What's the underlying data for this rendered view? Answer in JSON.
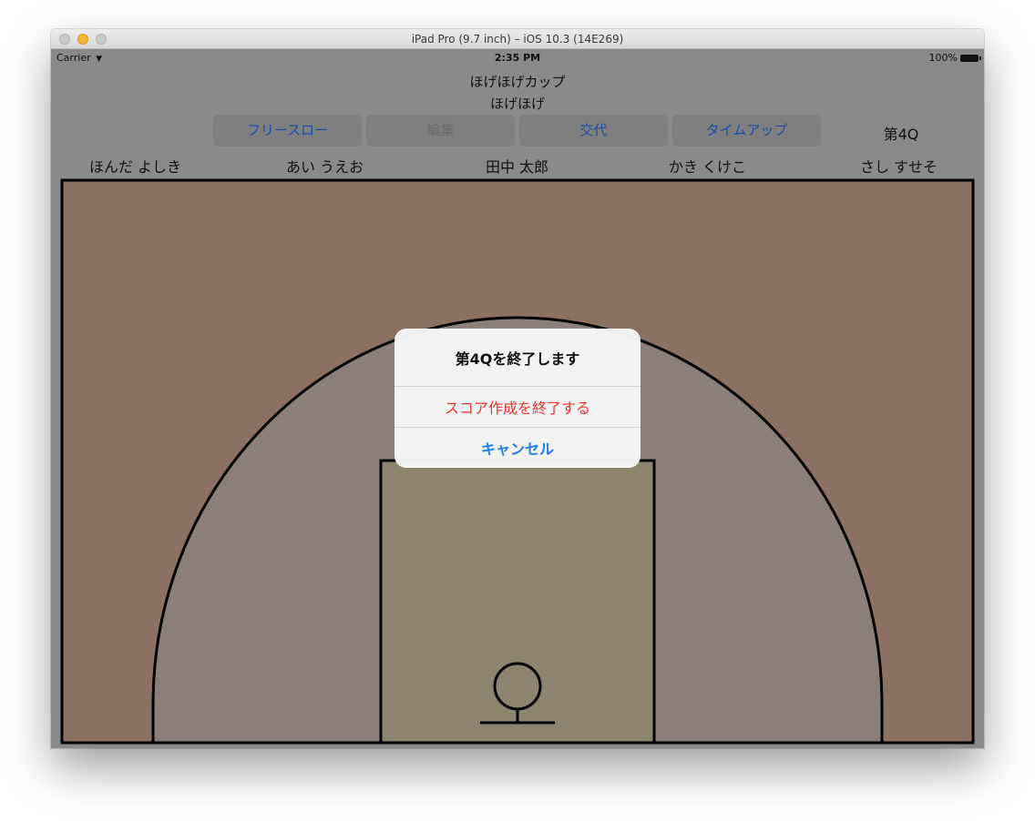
{
  "window": {
    "title": "iPad Pro (9.7 inch) – iOS 10.3 (14E269)"
  },
  "statusbar": {
    "carrier": "Carrier",
    "time": "2:35 PM",
    "battery": "100%"
  },
  "game": {
    "title": "ほげほげカップ",
    "subtitle": "ほげほげ"
  },
  "toolbar": {
    "free_throw": "フリースロー",
    "edit": "編集",
    "substitution": "交代",
    "time_up": "タイムアップ",
    "quarter": "第4Q"
  },
  "players": [
    "ほんだ よしき",
    "あい うえお",
    "田中 太郎",
    "かき くけこ",
    "さし すせそ"
  ],
  "dialog": {
    "title": "第4Qを終了します",
    "destructive_action": "スコア作成を終了する",
    "cancel": "キャンセル"
  },
  "colors": {
    "court_outer": "#8b7161",
    "three_point_area": "#8a8079",
    "key_area": "#8c846f",
    "button_text": "#1e4fa8",
    "destructive": "#e5332f",
    "cancel": "#1d7cf2"
  }
}
